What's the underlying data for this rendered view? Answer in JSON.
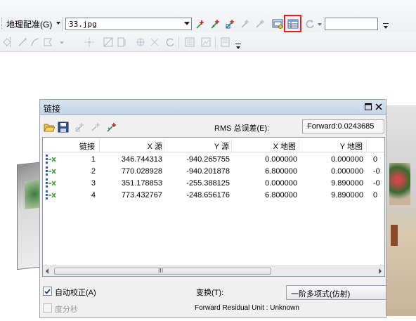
{
  "toolbar": {
    "georef_menu_label": "地理配准(G)",
    "layer_combo_value": "33.jpg",
    "scale_input_value": ""
  },
  "dialog": {
    "title": "链接",
    "rms_label": "RMS 总误差(E):",
    "rms_value": "Forward:0.0243685",
    "columns": [
      "链接",
      "X 源",
      "Y 源",
      "X 地图",
      "Y 地图"
    ],
    "rows": [
      {
        "link": "1",
        "x_src": "346.744313",
        "y_src": "-940.265755",
        "x_map": "0.000000",
        "y_map": "0.000000",
        "extra": "0"
      },
      {
        "link": "2",
        "x_src": "770.028928",
        "y_src": "-940.201878",
        "x_map": "6.800000",
        "y_map": "0.000000",
        "extra": "-0"
      },
      {
        "link": "3",
        "x_src": "351.178853",
        "y_src": "-255.388125",
        "x_map": "0.000000",
        "y_map": "9.890000",
        "extra": "-0"
      },
      {
        "link": "4",
        "x_src": "773.432767",
        "y_src": "-248.656176",
        "x_map": "6.800000",
        "y_map": "9.890000",
        "extra": "0"
      }
    ],
    "scroll_grip": "III",
    "auto_adjust_label": "自动校正(A)",
    "auto_adjust_checked": true,
    "dms_label": "度分秒",
    "dms_checked": false,
    "transform_label": "变换(T):",
    "transform_value": "一阶多项式(仿射)",
    "residual_text": "Forward Residual Unit : Unknown"
  },
  "colors": {
    "highlight": "#e0201c",
    "titlebar": "#c4d3e6",
    "link_icon_blue": "#2a62c9",
    "link_icon_green": "#2e9b2e"
  }
}
